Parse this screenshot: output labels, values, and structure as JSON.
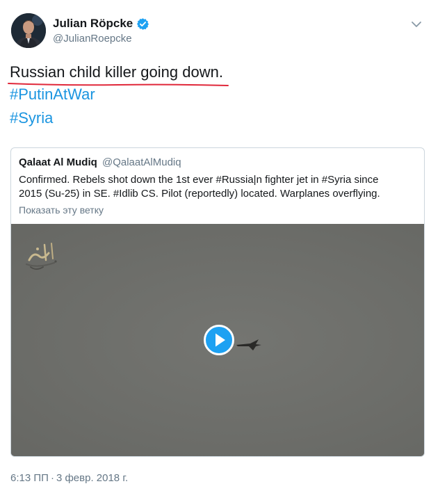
{
  "author": {
    "name": "Julian Röpcke",
    "handle": "@JulianRoepcke",
    "verified": true,
    "avatar_icon": "profile-photo"
  },
  "tweet": {
    "text": "Russian child killer going down.",
    "hashtags": [
      "#PutinAtWar",
      "#Syria"
    ]
  },
  "quoted_tweet": {
    "name": "Qalaat Al Mudiq",
    "handle": "@QalaatAlMudiq",
    "text_lines": [
      "Confirmed. Rebels shot down the 1st ever #Russia|n fighter jet in #Syria since",
      "2015 (Su-25) in SE. #Idlib CS. Pilot (reportedly) located. Warplanes overflying."
    ],
    "show_thread_label": "Показать эту ветку",
    "media": {
      "type": "video",
      "play_icon": "play-icon"
    }
  },
  "meta": {
    "time": "6:13 ПП",
    "separator": "·",
    "date": "3 февр. 2018 г."
  },
  "colors": {
    "link": "#1b95e0",
    "secondary_text": "#657786",
    "verified": "#1da1f2",
    "annotation_underline": "#e0283a",
    "card_border": "#ccd6dd"
  }
}
